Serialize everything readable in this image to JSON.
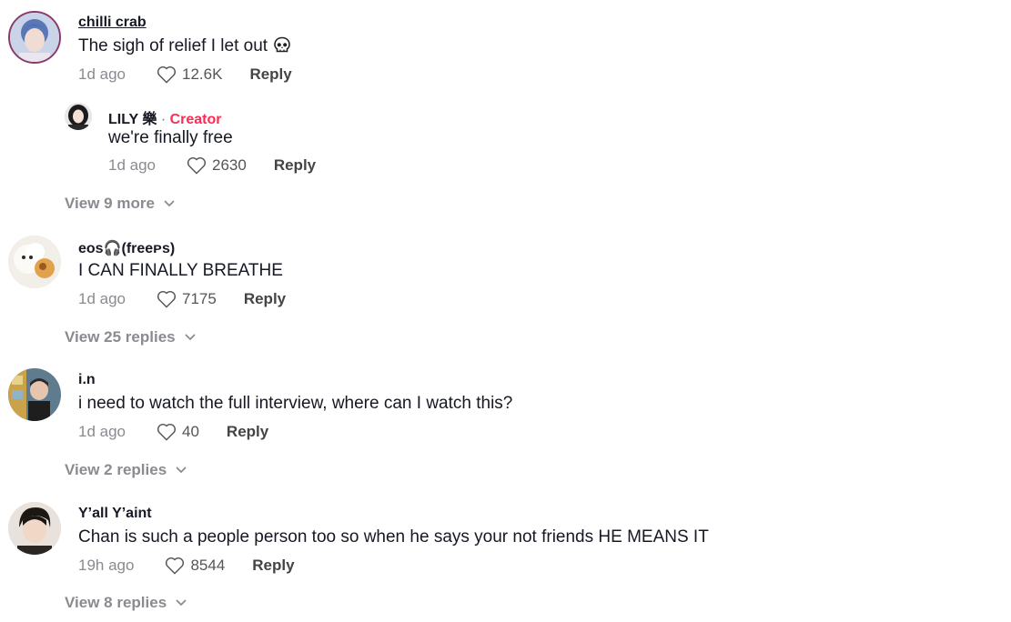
{
  "comments": [
    {
      "username": "chilli crab",
      "text": "The sigh of relief I let out",
      "emoji_icon": "skull-icon",
      "time": "1d ago",
      "likes": "12.6K",
      "reply_label": "Reply"
    },
    {
      "username": "eos🎧(freeᴘs)",
      "text": "I CAN FINALLY BREATHE",
      "time": "1d ago",
      "likes": "7175",
      "reply_label": "Reply",
      "view_replies": "View 25 replies"
    },
    {
      "username": "i.n",
      "text": "i need to watch the full interview, where can I watch this?",
      "time": "1d ago",
      "likes": "40",
      "reply_label": "Reply",
      "view_replies": "View 2 replies"
    },
    {
      "username": "Y’all Y’aint",
      "text": "Chan is such a people person too so when he says your not friends HE MEANS IT",
      "time": "19h ago",
      "likes": "8544",
      "reply_label": "Reply",
      "view_replies": "View 8 replies"
    }
  ],
  "reply": {
    "username": "LILY 樂",
    "separator": "·",
    "badge": "Creator",
    "text": "we're finally free",
    "time": "1d ago",
    "likes": "2630",
    "reply_label": "Reply"
  },
  "view_more_label": "View 9 more",
  "colors": {
    "creator_badge": "#fe2c55",
    "muted_text": "#8a8b91",
    "primary_text": "#161823"
  }
}
